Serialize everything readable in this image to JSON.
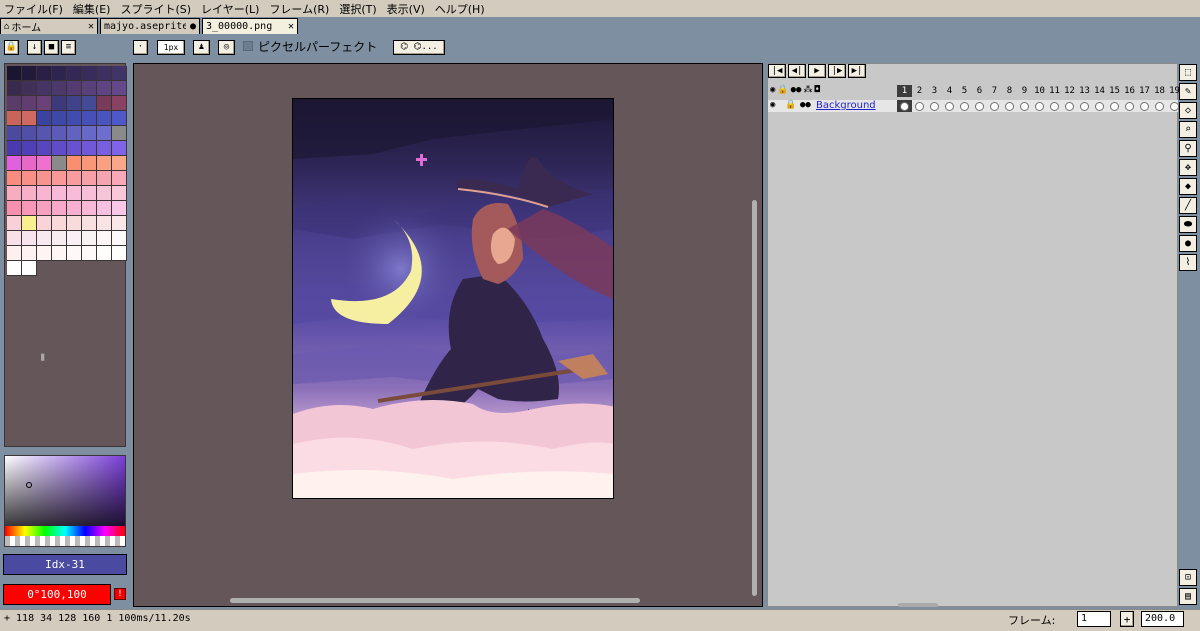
{
  "menu": [
    "ファイル(F)",
    "編集(E)",
    "スプライト(S)",
    "レイヤー(L)",
    "フレーム(R)",
    "選択(T)",
    "表示(V)",
    "ヘルプ(H)"
  ],
  "tabs": [
    {
      "label": "ホーム",
      "close": "✕",
      "icon": "home-icon"
    },
    {
      "label": "majyo.aseprite",
      "close": "●"
    },
    {
      "label": "3_00000.png",
      "close": "✕"
    }
  ],
  "context_bar": {
    "brush_size": "1px",
    "pixel_perfect_label": "ピクセルパーフェクト",
    "more_label": "..."
  },
  "palette": {
    "colors": [
      "#1a1530",
      "#221a3a",
      "#2a2045",
      "#2e2450",
      "#332856",
      "#382c5c",
      "#3d3060",
      "#413466",
      "#3a2a4e",
      "#40305a",
      "#463462",
      "#4c386a",
      "#523c72",
      "#58407a",
      "#5e4482",
      "#64488a",
      "#5a3c6a",
      "#623e70",
      "#6a4278",
      "#3c3a7a",
      "#40428a",
      "#444a94",
      "#7a3a5a",
      "#8a4262",
      "#c8645a",
      "#d06a60",
      "#3a44a0",
      "#3e48a8",
      "#424cb0",
      "#4650b8",
      "#4a54c0",
      "#4e58c8",
      "#4a4aa0",
      "#5050a8",
      "#5656b0",
      "#5c5cb8",
      "#6262c0",
      "#6868c8",
      "#6e6ed0",
      "#8a8a8a",
      "#4a3ab0",
      "#5040b8",
      "#5846c0",
      "#604cc8",
      "#6852d0",
      "#7058d8",
      "#785ee0",
      "#8064e8",
      "#e060e0",
      "#e868c8",
      "#f070d0",
      "#8a8a8a",
      "#f89070",
      "#f89878",
      "#f8a080",
      "#f8a888",
      "#f88c80",
      "#f89088",
      "#f89490",
      "#f89898",
      "#f89ca0",
      "#f8a0a8",
      "#f8a4b0",
      "#f8a8b8",
      "#f8acc0",
      "#f8b0c8",
      "#f8b4d0",
      "#f8b8d8",
      "#f8bcd8",
      "#f8c0d8",
      "#f8c4d8",
      "#f8c8d8",
      "#f890b0",
      "#f898b8",
      "#f8a0c0",
      "#f8a8c8",
      "#f8b0d0",
      "#f8b8d8",
      "#f8c0e0",
      "#f8c8e8",
      "#f8d0d8",
      "#f8f090",
      "#f8d4d8",
      "#f8d8d8",
      "#f8dcdc",
      "#f8e0e0",
      "#f8e4e4",
      "#f8e8e8",
      "#f8e0e8",
      "#f8e4ec",
      "#f8e8f0",
      "#f8ecf0",
      "#f8f0f4",
      "#f8f4f4",
      "#fff8f8",
      "#fffafa",
      "#fff0f0",
      "#fff2f2",
      "#fff4f4",
      "#fff6f6",
      "#fff8f8",
      "#fffafa",
      "#fffcfc",
      "#ffffff",
      "#ffffff",
      "#ffffff"
    ]
  },
  "color_bar": {
    "index_label": "Idx-31",
    "color_value": "0°100,100",
    "warn": "!"
  },
  "timeline": {
    "layer_name": "Background",
    "frames": [
      "1",
      "2",
      "3",
      "4",
      "5",
      "6",
      "7",
      "8",
      "9",
      "10",
      "11",
      "12",
      "13",
      "14",
      "15",
      "16",
      "17",
      "18",
      "19"
    ]
  },
  "status": {
    "text": "+ 118 34  128 160  1  100ms/11.20s",
    "frame_label": "フレーム:",
    "frame_value": "1",
    "plus": "+",
    "zoom": "200.0"
  }
}
